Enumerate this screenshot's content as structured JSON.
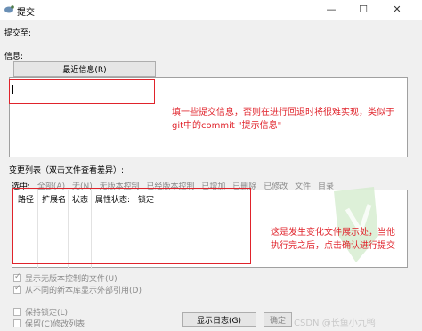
{
  "window": {
    "title": "提交",
    "minimize": "—",
    "maximize": "☐",
    "close": "✕"
  },
  "commit_to_label": "提交至:",
  "message_label": "信息:",
  "recent_messages_button": "最近信息(R)",
  "annotation_message": [
    "填一些提交信息，否则在进行回退时将很难实现，类似于",
    "git中的commit \"提示信息\""
  ],
  "changes_label": "变更列表（双击文件查看差异）:",
  "select_label": "选中:",
  "filters": [
    "全部(A)",
    "无(N)",
    "无版本控制",
    "已经版本控制",
    "已增加",
    "已删除",
    "已修改",
    "文件",
    "目录"
  ],
  "columns": [
    "路径",
    "扩展名",
    "状态",
    "属性状态:",
    "锁定"
  ],
  "annotation_list": [
    "这是发生变化文件展示处，当他",
    "执行完之后，点击确认进行提交"
  ],
  "options": [
    {
      "label": "显示无版本控制的文件(U)",
      "checked": true
    },
    {
      "label": "从不同的新本库显示外部引用(D)",
      "checked": true
    }
  ],
  "bottom_options": [
    {
      "label": "保持锁定(L)",
      "checked": false
    },
    {
      "label": "保留(C)修改列表",
      "checked": false
    }
  ],
  "show_log_button": "显示日志(G)",
  "ok_button": "确定",
  "watermark": "CSDN @长鱼小九鸭",
  "colors": {
    "accent": "#e0232b"
  }
}
